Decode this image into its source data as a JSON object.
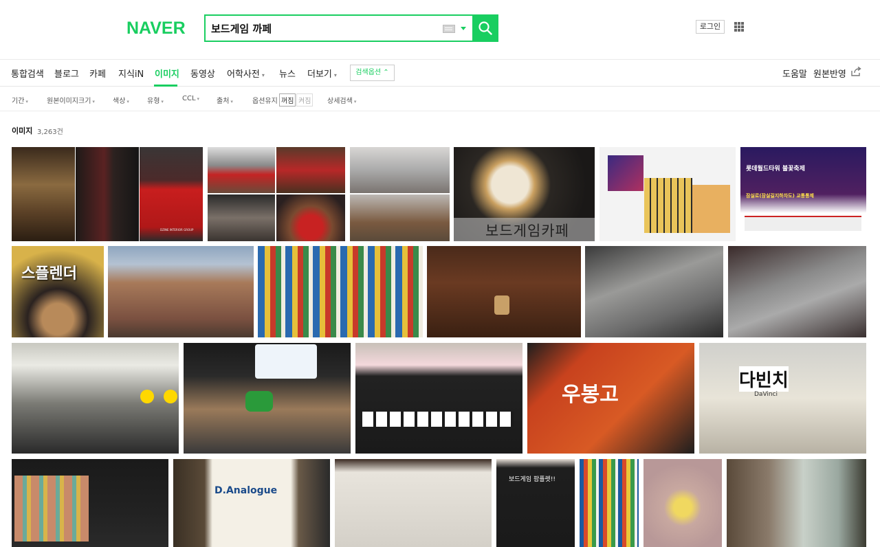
{
  "header": {
    "logo": "NAVER",
    "search_value": "보드게임 까페",
    "login_label": "로그인"
  },
  "tabs": [
    {
      "label": "통합검색"
    },
    {
      "label": "블로그"
    },
    {
      "label": "카페"
    },
    {
      "label": "지식iN"
    },
    {
      "label": "이미지",
      "active": true
    },
    {
      "label": "동영상"
    },
    {
      "label": "어학사전"
    },
    {
      "label": "뉴스"
    },
    {
      "label": "더보기"
    }
  ],
  "search_options_label": "검색옵션",
  "right_links": {
    "help": "도움말",
    "feedback": "원본반영"
  },
  "filters": [
    {
      "label": "기간"
    },
    {
      "label": "원본이미지크기"
    },
    {
      "label": "색상"
    },
    {
      "label": "유형"
    },
    {
      "label": "CCL"
    },
    {
      "label": "출처"
    },
    {
      "label": "옵션유지"
    },
    {
      "label": "상세검색"
    }
  ],
  "option_keep": {
    "off": "꺼짐",
    "on": "켜짐"
  },
  "results": {
    "title": "이미지",
    "count": "3,263건"
  },
  "image_captions": {
    "cafe_text": "보드게임카페",
    "splendor": "스플렌더",
    "ubongo": "우봉고",
    "davinci": "다빈치",
    "davinci_sub": "DaVinci",
    "analogue": "D.Analogue",
    "banner_title": "롯데월드타워 불꽃축제",
    "banner_sub": "잠실로(잠실길지하차도) 교통통제",
    "dzine": "DZINE INTERIOR GROUP",
    "menu_board": "보드게임 팜플렛!!"
  },
  "colors": {
    "brand": "#19ce60"
  }
}
